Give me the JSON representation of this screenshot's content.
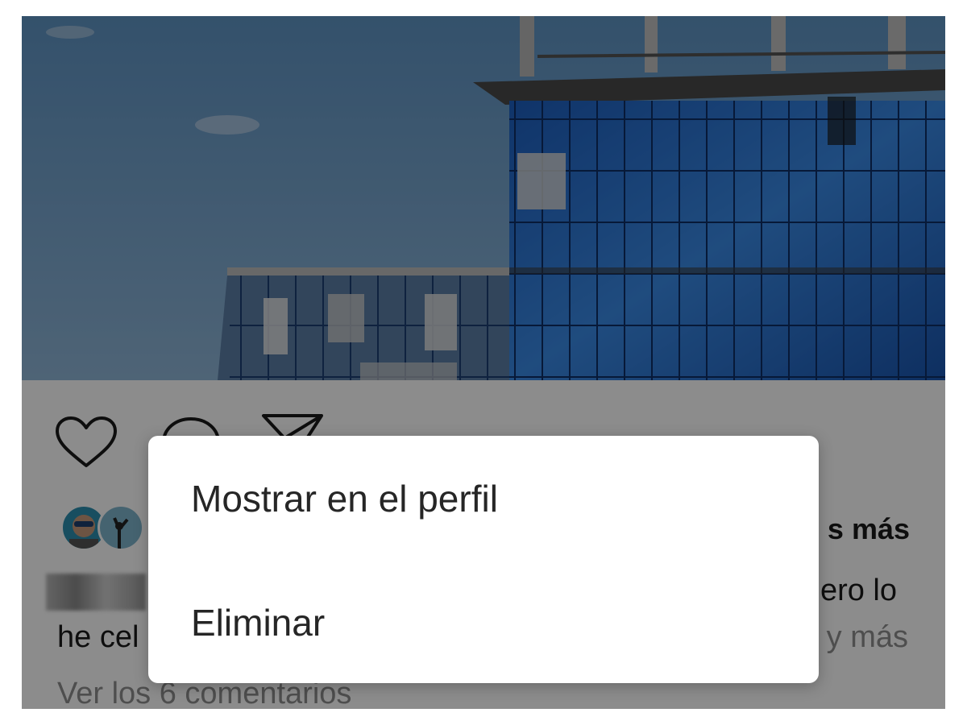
{
  "post": {
    "liked_by_suffix": "s más",
    "caption_end": "ero lo",
    "caption_start": "he cel",
    "more_link": "y más",
    "view_comments": "Ver los 6 comentarios"
  },
  "icons": {
    "like": "heart-outline-icon",
    "comment": "comment-bubble-icon",
    "share": "paper-plane-icon"
  },
  "dialog": {
    "items": [
      {
        "label": "Mostrar en el perfil"
      },
      {
        "label": "Eliminar"
      }
    ]
  },
  "colors": {
    "sky": "#5b8fc0",
    "glass": "#1f6fd0",
    "overlay": "rgba(0,0,0,0.45)",
    "dialog_bg": "#ffffff",
    "text": "#262626",
    "muted": "#8e8e8e"
  }
}
